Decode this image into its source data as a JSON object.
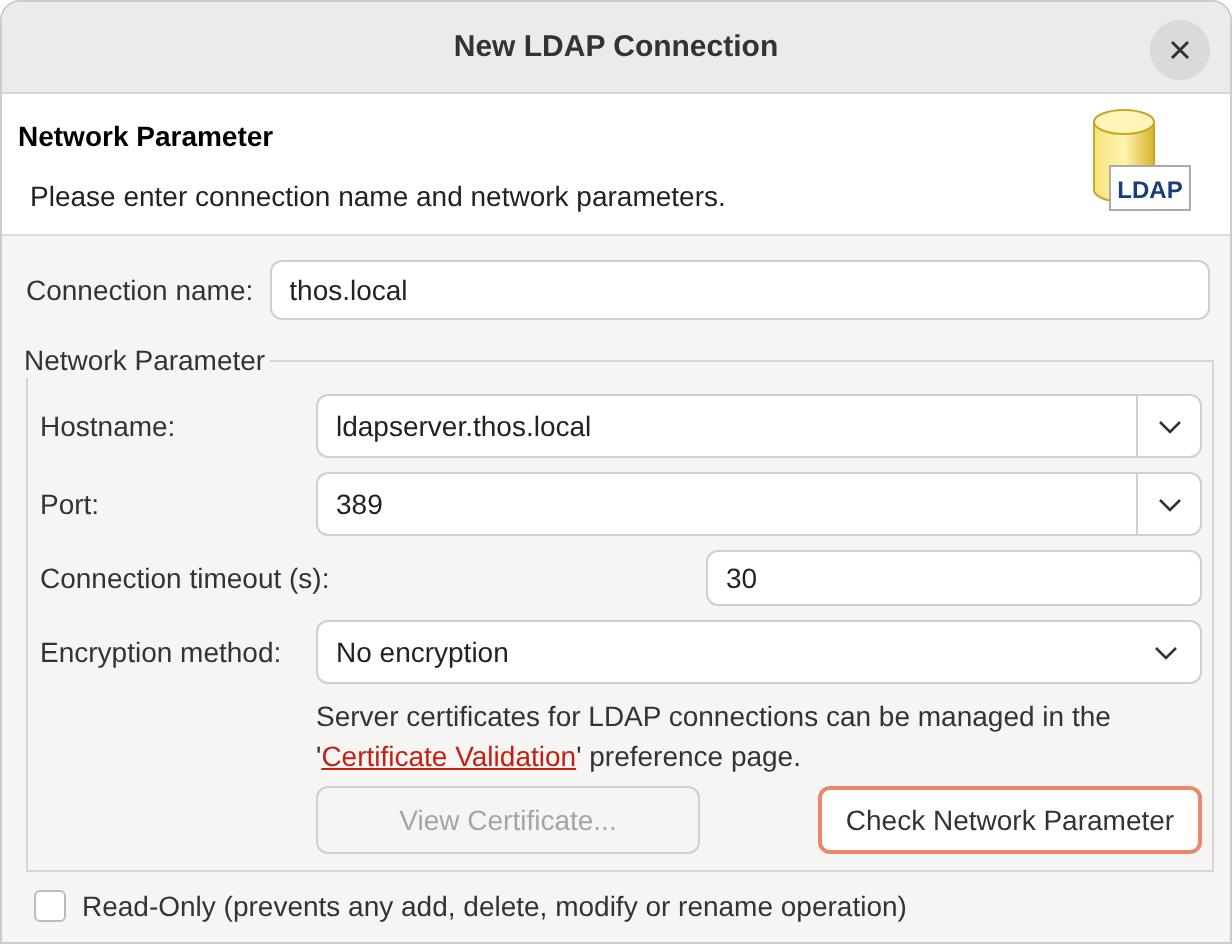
{
  "window": {
    "title": "New LDAP Connection"
  },
  "header": {
    "title": "Network Parameter",
    "description": "Please enter connection name and network parameters.",
    "logo_label": "LDAP"
  },
  "connection_name": {
    "label": "Connection name:",
    "value": "thos.local"
  },
  "network_group": {
    "legend": "Network Parameter",
    "fields": [
      {
        "kind": "combo",
        "label": "Hostname:",
        "value": "ldapserver.thos.local"
      },
      {
        "kind": "combo",
        "label": "Port:",
        "value": "389"
      },
      {
        "kind": "text",
        "label": "Connection timeout (s):",
        "value": "30"
      },
      {
        "kind": "select",
        "label": "Encryption method:",
        "value": "No encryption"
      }
    ],
    "note": {
      "before": "Server certificates for LDAP connections can be managed in the '",
      "link": "Certificate Validation",
      "after": "' preference page."
    },
    "buttons": [
      {
        "label": "View Certificate...",
        "disabled": true,
        "focused": false
      },
      {
        "label": "Check Network Parameter",
        "disabled": false,
        "focused": true
      }
    ]
  },
  "read_only": {
    "label": "Read-Only (prevents any add, delete, modify or rename operation)",
    "checked": false
  }
}
